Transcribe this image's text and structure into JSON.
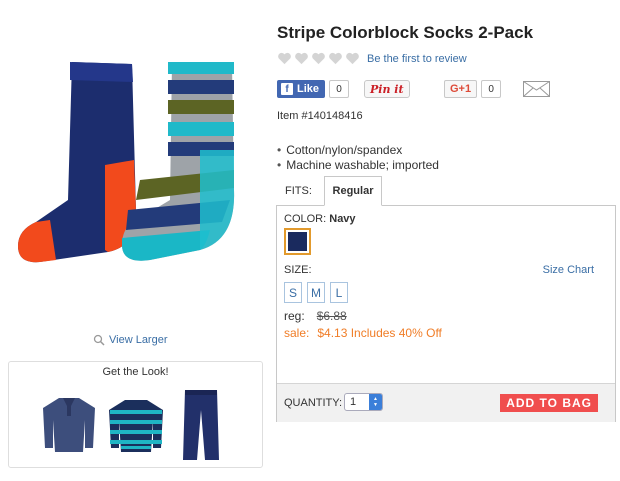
{
  "product": {
    "title": "Stripe Colorblock Socks 2-Pack",
    "review_link": "Be the first to review",
    "item_number": "Item #140148416",
    "features": [
      "Cotton/nylon/spandex",
      "Machine washable; imported"
    ]
  },
  "gallery": {
    "view_larger": "View Larger",
    "get_the_look": "Get the Look!"
  },
  "social": {
    "fb_like_label": "Like",
    "fb_count": "0",
    "pin_label": "Pin it",
    "gplus_label": "G+1",
    "gplus_count": "0"
  },
  "fits": {
    "label": "FITS:",
    "selected_tab": "Regular"
  },
  "options": {
    "color_label": "COLOR:",
    "color_value": "Navy",
    "size_label": "SIZE:",
    "size_chart": "Size Chart",
    "sizes": [
      "S",
      "M",
      "L"
    ]
  },
  "pricing": {
    "reg_label": "reg:",
    "reg_price": "$6.88",
    "sale_label": "sale:",
    "sale_text": "$4.13 Includes 40% Off"
  },
  "purchase": {
    "quantity_label": "QUANTITY:",
    "quantity_value": "1",
    "add_to_bag": "ADD TO BAG"
  },
  "colors": {
    "link": "#3a6ea5",
    "sale": "#f07d27",
    "add_to_bag": "#f04e4e",
    "facebook": "#4267b2",
    "swatch_navy": "#1a2a5e"
  }
}
